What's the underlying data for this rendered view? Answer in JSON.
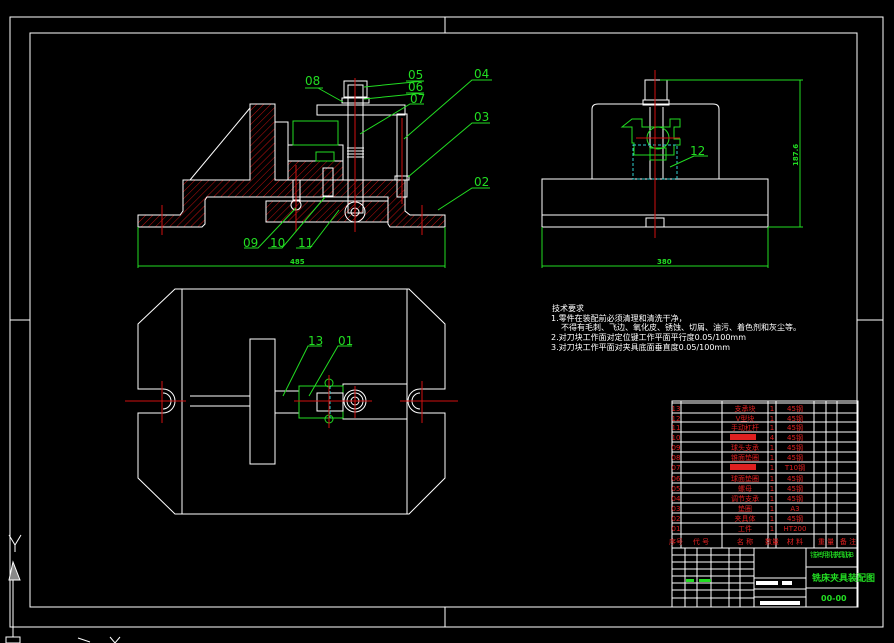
{
  "colors": {
    "background": "#000000",
    "outline": "#ffffff",
    "hatch": "#d01010",
    "leader": "#22dd22",
    "centerline": "#d01010",
    "hidden": "#30d0d0"
  },
  "front_view": {
    "labels": [
      "08",
      "05",
      "06",
      "07",
      "04",
      "03",
      "02",
      "09",
      "10",
      "11"
    ],
    "dimension": "485"
  },
  "side_view": {
    "labels": [
      "12"
    ],
    "dimension_width": "380",
    "dimension_height": "187.6"
  },
  "top_view": {
    "labels": [
      "13",
      "01"
    ]
  },
  "notes": {
    "title": "技术要求",
    "lines": [
      "1.零件在装配前必须清理和清洗干净，",
      "不得有毛刺、飞边、氧化皮、锈蚀、切屑、油污、着色剂和灰尘等。",
      "2.对刀块工作面对定位键工作平面平行度0.05/100mm",
      "3.对刀块工作平面对夹具底面垂直度0.05/100mm"
    ]
  },
  "bom": {
    "rows": [
      {
        "no": "13",
        "name": "支承块",
        "qty": "1",
        "material": "45钢"
      },
      {
        "no": "12",
        "name": "V型块",
        "qty": "1",
        "material": "45钢"
      },
      {
        "no": "11",
        "name": "手动杠杆",
        "qty": "1",
        "material": "45钢"
      },
      {
        "no": "10",
        "name": "",
        "qty": "4",
        "material": "45钢",
        "redacted": true
      },
      {
        "no": "09",
        "name": "球头支承",
        "qty": "1",
        "material": "45钢"
      },
      {
        "no": "08",
        "name": "锥面垫圈",
        "qty": "1",
        "material": "45钢"
      },
      {
        "no": "07",
        "name": "",
        "qty": "1",
        "material": "T10钢",
        "redacted": true
      },
      {
        "no": "06",
        "name": "球面垫圈",
        "qty": "1",
        "material": "45钢"
      },
      {
        "no": "05",
        "name": "螺母",
        "qty": "1",
        "material": "45钢"
      },
      {
        "no": "04",
        "name": "调节支承",
        "qty": "1",
        "material": "45钢"
      },
      {
        "no": "03",
        "name": "垫圈",
        "qty": "1",
        "material": "A3"
      },
      {
        "no": "02",
        "name": "夹具体",
        "qty": "1",
        "material": "45钢"
      },
      {
        "no": "01",
        "name": "工件",
        "qty": "1",
        "material": "HT200"
      }
    ],
    "header": {
      "no": "序号",
      "code": "代 号",
      "name": "名 称",
      "qty": "数量",
      "material": "材 料",
      "weight": "重 量",
      "remark": "备 注"
    }
  },
  "title_block": {
    "school": "铣床专用机械夹具 机床B",
    "drawing_title": "铣床夹具装配图",
    "drawing_no": "00-00"
  },
  "ucs": {
    "axis_label": "Y"
  }
}
